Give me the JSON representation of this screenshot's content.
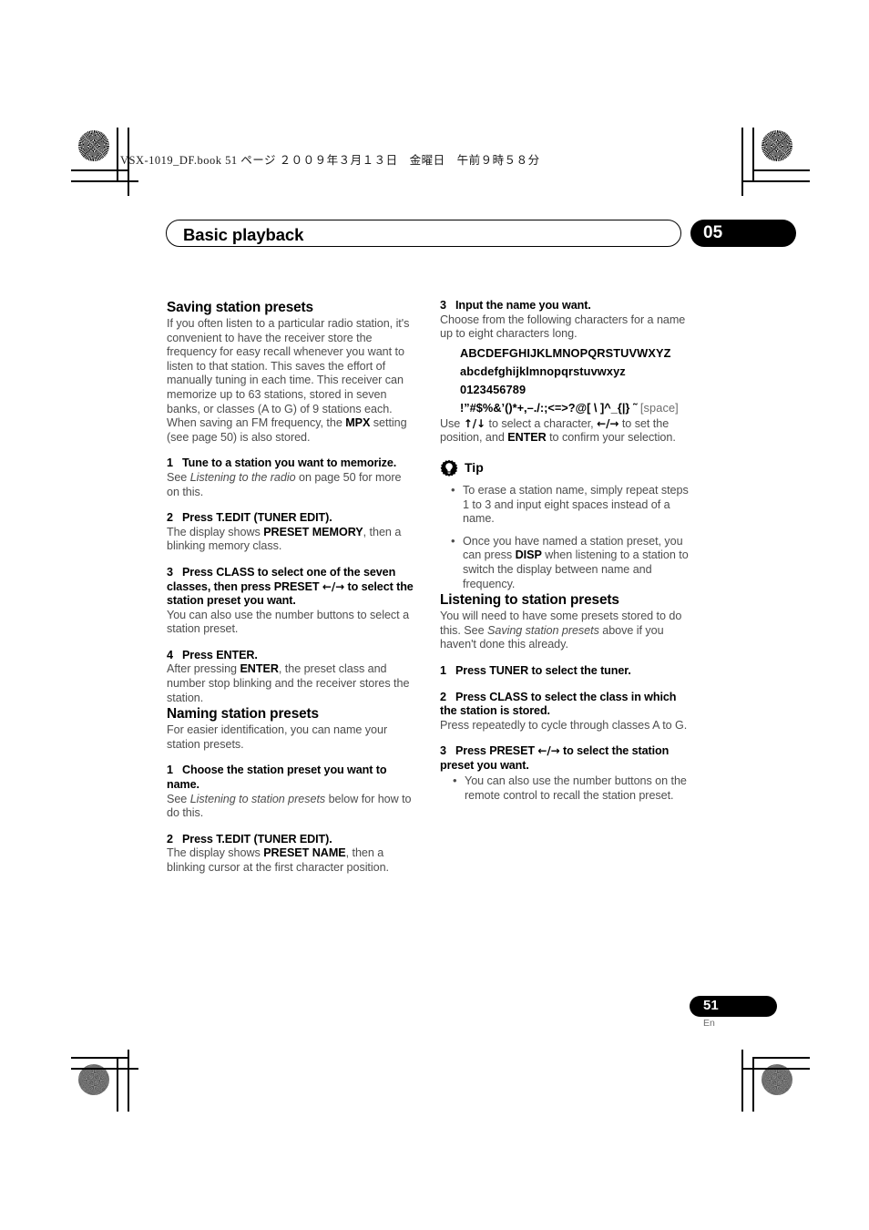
{
  "print_header": "VSX-1019_DF.book   51 ページ   ２００９年３月１３日　金曜日　午前９時５８分",
  "chapter": {
    "title": "Basic playback",
    "number": "05"
  },
  "footer": {
    "page_number": "51",
    "language": "En"
  },
  "left_column": {
    "section1": {
      "heading": "Saving station presets",
      "intro_part1": "If you often listen to a particular radio station, it's convenient to have the receiver store the frequency for easy recall whenever you want to listen to that station. This saves the effort of manually tuning in each time. This receiver can memorize up to 63 stations, stored in seven banks, or classes (A to G) of 9 stations each. When saving an FM frequency, the ",
      "intro_kw": "MPX",
      "intro_part2": " setting (see page 50) is also stored.",
      "steps": [
        {
          "num": "1",
          "head": "Tune to a station you want to memorize.",
          "body_part1": "See ",
          "body_italic": "Listening to the radio",
          "body_part2": " on page 50 for more on this."
        },
        {
          "num": "2",
          "head": "Press T.EDIT (TUNER EDIT).",
          "body_part1": "The display shows ",
          "body_kw": "PRESET MEMORY",
          "body_part2": ", then a blinking memory class."
        },
        {
          "num": "3",
          "head_part1": "Press CLASS to select one of the seven classes, then press PRESET ",
          "head_arrows": "←/→",
          "head_part2": " to select the station preset you want.",
          "body": "You can also use the number buttons to select a station preset."
        },
        {
          "num": "4",
          "head": "Press ENTER.",
          "body_part1": "After pressing ",
          "body_kw": "ENTER",
          "body_part2": ", the preset class and number stop blinking and the receiver stores the station."
        }
      ]
    },
    "section2": {
      "heading": "Naming station presets",
      "intro": "For easier identification, you can name your station presets.",
      "steps": [
        {
          "num": "1",
          "head": "Choose the station preset you want to name.",
          "body_part1": "See ",
          "body_italic": "Listening to station presets",
          "body_part2": " below for how to do this."
        },
        {
          "num": "2",
          "head": "Press T.EDIT (TUNER EDIT).",
          "body_part1": "The display shows ",
          "body_kw": "PRESET NAME",
          "body_part2": ", then a blinking cursor at the first character position."
        }
      ]
    }
  },
  "right_column": {
    "step3": {
      "num": "3",
      "head": "Input the name you want.",
      "body": "Choose from the following characters for a name up to eight characters long.",
      "charset": [
        "ABCDEFGHIJKLMNOPQRSTUVWXYZ",
        "abcdefghijklmnopqrstuvwxyz",
        "0123456789"
      ],
      "charset_symbols": "!”#$%&’()*+,–./:;<=>?@[ \\ ]^_{|} ˜",
      "charset_space_label": "[space]",
      "use_part1": "Use ",
      "use_arrows_ud": "↑/↓",
      "use_part2": " to select a character, ",
      "use_arrows_lr": "←/→",
      "use_part3": " to set the position, and ",
      "use_kw": "ENTER",
      "use_part4": " to confirm your selection."
    },
    "tip": {
      "label": "Tip",
      "icon": "gear-lightbulb-icon",
      "bullets": [
        {
          "text": "To erase a station name, simply repeat steps 1 to 3 and input eight spaces instead of a name."
        },
        {
          "part1": "Once you have named a station preset, you can press ",
          "kw": "DISP",
          "part2": " when listening to a station to switch the display between name and frequency."
        }
      ]
    },
    "section": {
      "heading": "Listening to station presets",
      "intro_part1": "You will need to have some presets stored to do this. See ",
      "intro_italic": "Saving station presets",
      "intro_part2": " above if you haven't done this already.",
      "steps": [
        {
          "num": "1",
          "head": "Press TUNER to select the tuner."
        },
        {
          "num": "2",
          "head": "Press CLASS to select the class in which the station is stored.",
          "body": "Press repeatedly to cycle through classes A to G."
        },
        {
          "num": "3",
          "head_part1": "Press PRESET ",
          "head_arrows": "←/→",
          "head_part2": " to select the station preset you want.",
          "bullet": "You can also use the number buttons on the remote control to recall the station preset."
        }
      ]
    }
  }
}
